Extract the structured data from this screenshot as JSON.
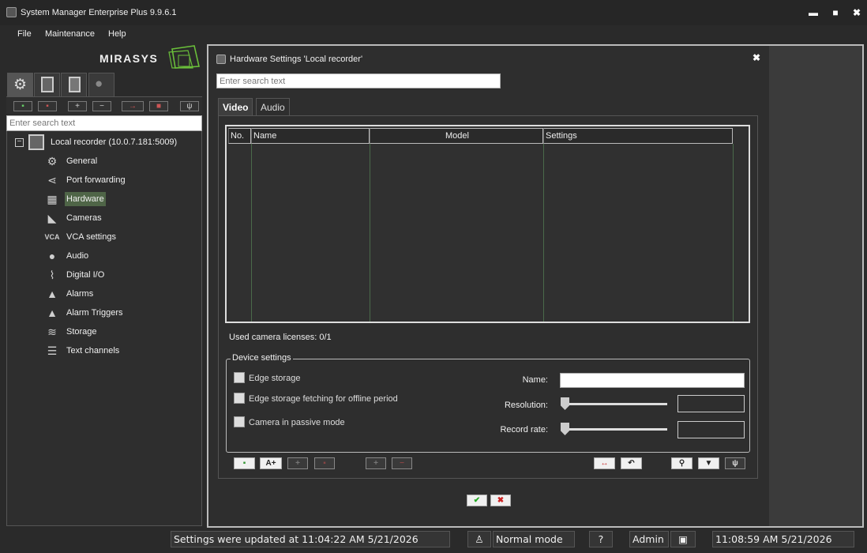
{
  "app": {
    "title": "System Manager Enterprise Plus 9.9.6.1"
  },
  "window_controls": {
    "minimize": "▬",
    "maximize": "■",
    "close": "✖"
  },
  "menu": {
    "items": [
      "File",
      "Maintenance",
      "Help"
    ]
  },
  "logo": {
    "text": "MIRASYS"
  },
  "sidebar": {
    "search_placeholder": "Enter search text",
    "root": {
      "label": "Local recorder (10.0.7.181:5009)",
      "expander": "−"
    },
    "items": [
      {
        "label": "General",
        "icon": "gear-icon",
        "glyph": "⚙"
      },
      {
        "label": "Port forwarding",
        "icon": "share-icon",
        "glyph": "⋖"
      },
      {
        "label": "Hardware",
        "icon": "chip-icon",
        "glyph": "▦",
        "selected": true
      },
      {
        "label": "Cameras",
        "icon": "camera-icon",
        "glyph": "◣"
      },
      {
        "label": "VCA settings",
        "icon": "vca-icon",
        "glyph": "VCA"
      },
      {
        "label": "Audio",
        "icon": "microphone-icon",
        "glyph": "●"
      },
      {
        "label": "Digital I/O",
        "icon": "io-icon",
        "glyph": "⌇"
      },
      {
        "label": "Alarms",
        "icon": "bell-icon",
        "glyph": "▲"
      },
      {
        "label": "Alarm Triggers",
        "icon": "bell-plus-icon",
        "glyph": "▲"
      },
      {
        "label": "Storage",
        "icon": "layers-icon",
        "glyph": "≋"
      },
      {
        "label": "Text channels",
        "icon": "text-list-icon",
        "glyph": "☰"
      }
    ]
  },
  "dialog": {
    "title": "Hardware Settings 'Local recorder'",
    "search_placeholder": "Enter search text",
    "tabs": [
      {
        "label": "Video",
        "active": true
      },
      {
        "label": "Audio",
        "active": false
      }
    ],
    "grid_headers": [
      "No.",
      "Name",
      "Model",
      "Settings"
    ],
    "licenses": "Used camera licenses: 0/1",
    "device_settings": {
      "legend": "Device settings",
      "checkboxes": [
        "Edge storage",
        "Edge storage fetching for offline period",
        "Camera in passive mode"
      ],
      "name_label": "Name:",
      "resolution_label": "Resolution:",
      "record_rate_label": "Record rate:",
      "name_value": ""
    },
    "bottom_buttons": {
      "add_text": "A+",
      "plus": "+",
      "minus": "−"
    },
    "ok": "✔",
    "cancel": "✖"
  },
  "status": {
    "message": "Settings were updated at 11:04:22 AM 5/21/2026",
    "mode": "Normal mode",
    "help": "?",
    "user": "Admin",
    "clock": "11:08:59 AM 5/21/2026"
  },
  "colors": {
    "accent_green": "#4f6547",
    "logo_green": "#6abf3a"
  }
}
